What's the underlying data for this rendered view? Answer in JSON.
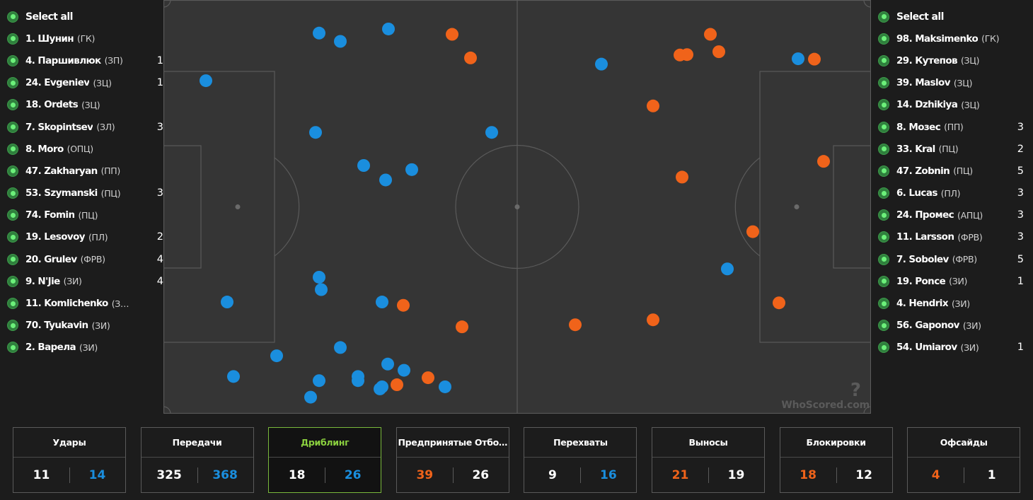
{
  "colors": {
    "home": "#1a8ede",
    "away": "#f0631a",
    "neutral": "#ffffff",
    "active_border": "#79b83c",
    "active_text": "#8bd13f",
    "pitch": "#353535",
    "pitch_lines": "#5a5a5a"
  },
  "left_team": {
    "select_all_label": "Select all",
    "players": [
      {
        "name": "1. Шунин",
        "pos": "(ГК)",
        "count": ""
      },
      {
        "name": "4. Паршивлюк",
        "pos": "(ЗП)",
        "count": "1"
      },
      {
        "name": "24. Evgeniev",
        "pos": "(ЗЦ)",
        "count": "1"
      },
      {
        "name": "18. Ordets",
        "pos": "(ЗЦ)",
        "count": ""
      },
      {
        "name": "7. Skopintsev",
        "pos": "(ЗЛ)",
        "count": "3"
      },
      {
        "name": "8. Moro",
        "pos": "(ОПЦ)",
        "count": ""
      },
      {
        "name": "47. Zakharyan",
        "pos": "(ПП)",
        "count": ""
      },
      {
        "name": "53. Szymanski",
        "pos": "(ПЦ)",
        "count": "3"
      },
      {
        "name": "74. Fomin",
        "pos": "(ПЦ)",
        "count": ""
      },
      {
        "name": "19. Lesovoy",
        "pos": "(ПЛ)",
        "count": "2"
      },
      {
        "name": "20. Grulev",
        "pos": "(ФРВ)",
        "count": "4"
      },
      {
        "name": "9. N'Jie",
        "pos": "(ЗИ)",
        "count": "4"
      },
      {
        "name": "11. Komlichenko",
        "pos": "(З…",
        "count": ""
      },
      {
        "name": "70. Tyukavin",
        "pos": "(ЗИ)",
        "count": ""
      },
      {
        "name": "2. Варела",
        "pos": "(ЗИ)",
        "count": ""
      }
    ]
  },
  "right_team": {
    "select_all_label": "Select all",
    "players": [
      {
        "name": "98. Maksimenko",
        "pos": "(ГК)",
        "count": ""
      },
      {
        "name": "29. Кутепов",
        "pos": "(ЗЦ)",
        "count": ""
      },
      {
        "name": "39. Maslov",
        "pos": "(ЗЦ)",
        "count": ""
      },
      {
        "name": "14. Dzhikiya",
        "pos": "(ЗЦ)",
        "count": ""
      },
      {
        "name": "8. Мозес",
        "pos": "(ПП)",
        "count": "3"
      },
      {
        "name": "33. Kral",
        "pos": "(ПЦ)",
        "count": "2"
      },
      {
        "name": "47. Zobnin",
        "pos": "(ПЦ)",
        "count": "5"
      },
      {
        "name": "6. Lucas",
        "pos": "(ПЛ)",
        "count": "3"
      },
      {
        "name": "24. Промес",
        "pos": "(АПЦ)",
        "count": "3"
      },
      {
        "name": "11. Larsson",
        "pos": "(ФРВ)",
        "count": "3"
      },
      {
        "name": "7. Sobolev",
        "pos": "(ФРВ)",
        "count": "5"
      },
      {
        "name": "19. Ponce",
        "pos": "(ЗИ)",
        "count": "1"
      },
      {
        "name": "4. Hendrix",
        "pos": "(ЗИ)",
        "count": ""
      },
      {
        "name": "56. Gaponov",
        "pos": "(ЗИ)",
        "count": ""
      },
      {
        "name": "54. Umiarov",
        "pos": "(ЗИ)",
        "count": "1"
      }
    ]
  },
  "pitch": {
    "watermark": "WhoScored.com",
    "events": [
      {
        "team": "home",
        "x": 22,
        "y": 92
      },
      {
        "team": "home",
        "x": 25,
        "y": 84
      },
      {
        "team": "home",
        "x": 31.7,
        "y": 88
      },
      {
        "team": "home",
        "x": 22,
        "y": 67
      },
      {
        "team": "home",
        "x": 22.3,
        "y": 70
      },
      {
        "team": "home",
        "x": 9,
        "y": 73
      },
      {
        "team": "home",
        "x": 16,
        "y": 86
      },
      {
        "team": "home",
        "x": 9.9,
        "y": 91
      },
      {
        "team": "home",
        "x": 20.8,
        "y": 96
      },
      {
        "team": "home",
        "x": 27.5,
        "y": 91
      },
      {
        "team": "home",
        "x": 27.5,
        "y": 92
      },
      {
        "team": "home",
        "x": 30.6,
        "y": 94
      },
      {
        "team": "home",
        "x": 30.9,
        "y": 93.5
      },
      {
        "team": "home",
        "x": 34,
        "y": 89.5
      },
      {
        "team": "home",
        "x": 39.8,
        "y": 93.5
      },
      {
        "team": "home",
        "x": 30.9,
        "y": 73
      },
      {
        "team": "home",
        "x": 22,
        "y": 8
      },
      {
        "team": "home",
        "x": 25,
        "y": 10
      },
      {
        "team": "home",
        "x": 31.8,
        "y": 7
      },
      {
        "team": "home",
        "x": 6,
        "y": 19.5
      },
      {
        "team": "home",
        "x": 21.5,
        "y": 32
      },
      {
        "team": "home",
        "x": 46.4,
        "y": 32
      },
      {
        "team": "home",
        "x": 28.3,
        "y": 40
      },
      {
        "team": "home",
        "x": 31.4,
        "y": 43.5
      },
      {
        "team": "home",
        "x": 35.1,
        "y": 41
      },
      {
        "team": "home",
        "x": 61.9,
        "y": 15.5
      },
      {
        "team": "away",
        "x": 40.8,
        "y": 8.3
      },
      {
        "team": "away",
        "x": 43.4,
        "y": 14
      },
      {
        "team": "away",
        "x": 73,
        "y": 13.3
      },
      {
        "team": "away",
        "x": 74,
        "y": 13.2
      },
      {
        "team": "away",
        "x": 77.3,
        "y": 8.3
      },
      {
        "team": "away",
        "x": 78.5,
        "y": 12.5
      },
      {
        "team": "away",
        "x": 92,
        "y": 14.3
      },
      {
        "team": "away",
        "x": 69.2,
        "y": 25.6
      },
      {
        "team": "away",
        "x": 93.3,
        "y": 39
      },
      {
        "team": "away",
        "x": 73.3,
        "y": 42.8
      },
      {
        "team": "away",
        "x": 83.3,
        "y": 56
      },
      {
        "team": "away",
        "x": 33.9,
        "y": 73.8
      },
      {
        "team": "away",
        "x": 42.2,
        "y": 79
      },
      {
        "team": "away",
        "x": 58.2,
        "y": 78.5
      },
      {
        "team": "away",
        "x": 69.2,
        "y": 77.3
      },
      {
        "team": "away",
        "x": 87,
        "y": 73.2
      },
      {
        "team": "away",
        "x": 33,
        "y": 93
      },
      {
        "team": "away",
        "x": 37.4,
        "y": 91.3
      },
      {
        "team": "home",
        "x": 89.7,
        "y": 14.2
      },
      {
        "team": "home",
        "x": 79.7,
        "y": 65
      }
    ]
  },
  "stats": [
    {
      "title": "Удары",
      "left": "11",
      "right": "14",
      "left_color": "#ffffff",
      "right_color": "#1a8ede",
      "active": false
    },
    {
      "title": "Передачи",
      "left": "325",
      "right": "368",
      "left_color": "#ffffff",
      "right_color": "#1a8ede",
      "active": false
    },
    {
      "title": "Дриблинг",
      "left": "18",
      "right": "26",
      "left_color": "#ffffff",
      "right_color": "#1a8ede",
      "active": true
    },
    {
      "title": "Предпринятые Отбо…",
      "left": "39",
      "right": "26",
      "left_color": "#f0631a",
      "right_color": "#ffffff",
      "active": false
    },
    {
      "title": "Перехваты",
      "left": "9",
      "right": "16",
      "left_color": "#ffffff",
      "right_color": "#1a8ede",
      "active": false
    },
    {
      "title": "Выносы",
      "left": "21",
      "right": "19",
      "left_color": "#f0631a",
      "right_color": "#ffffff",
      "active": false
    },
    {
      "title": "Блокировки",
      "left": "18",
      "right": "12",
      "left_color": "#f0631a",
      "right_color": "#ffffff",
      "active": false
    },
    {
      "title": "Офсайды",
      "left": "4",
      "right": "1",
      "left_color": "#f0631a",
      "right_color": "#ffffff",
      "active": false
    }
  ]
}
